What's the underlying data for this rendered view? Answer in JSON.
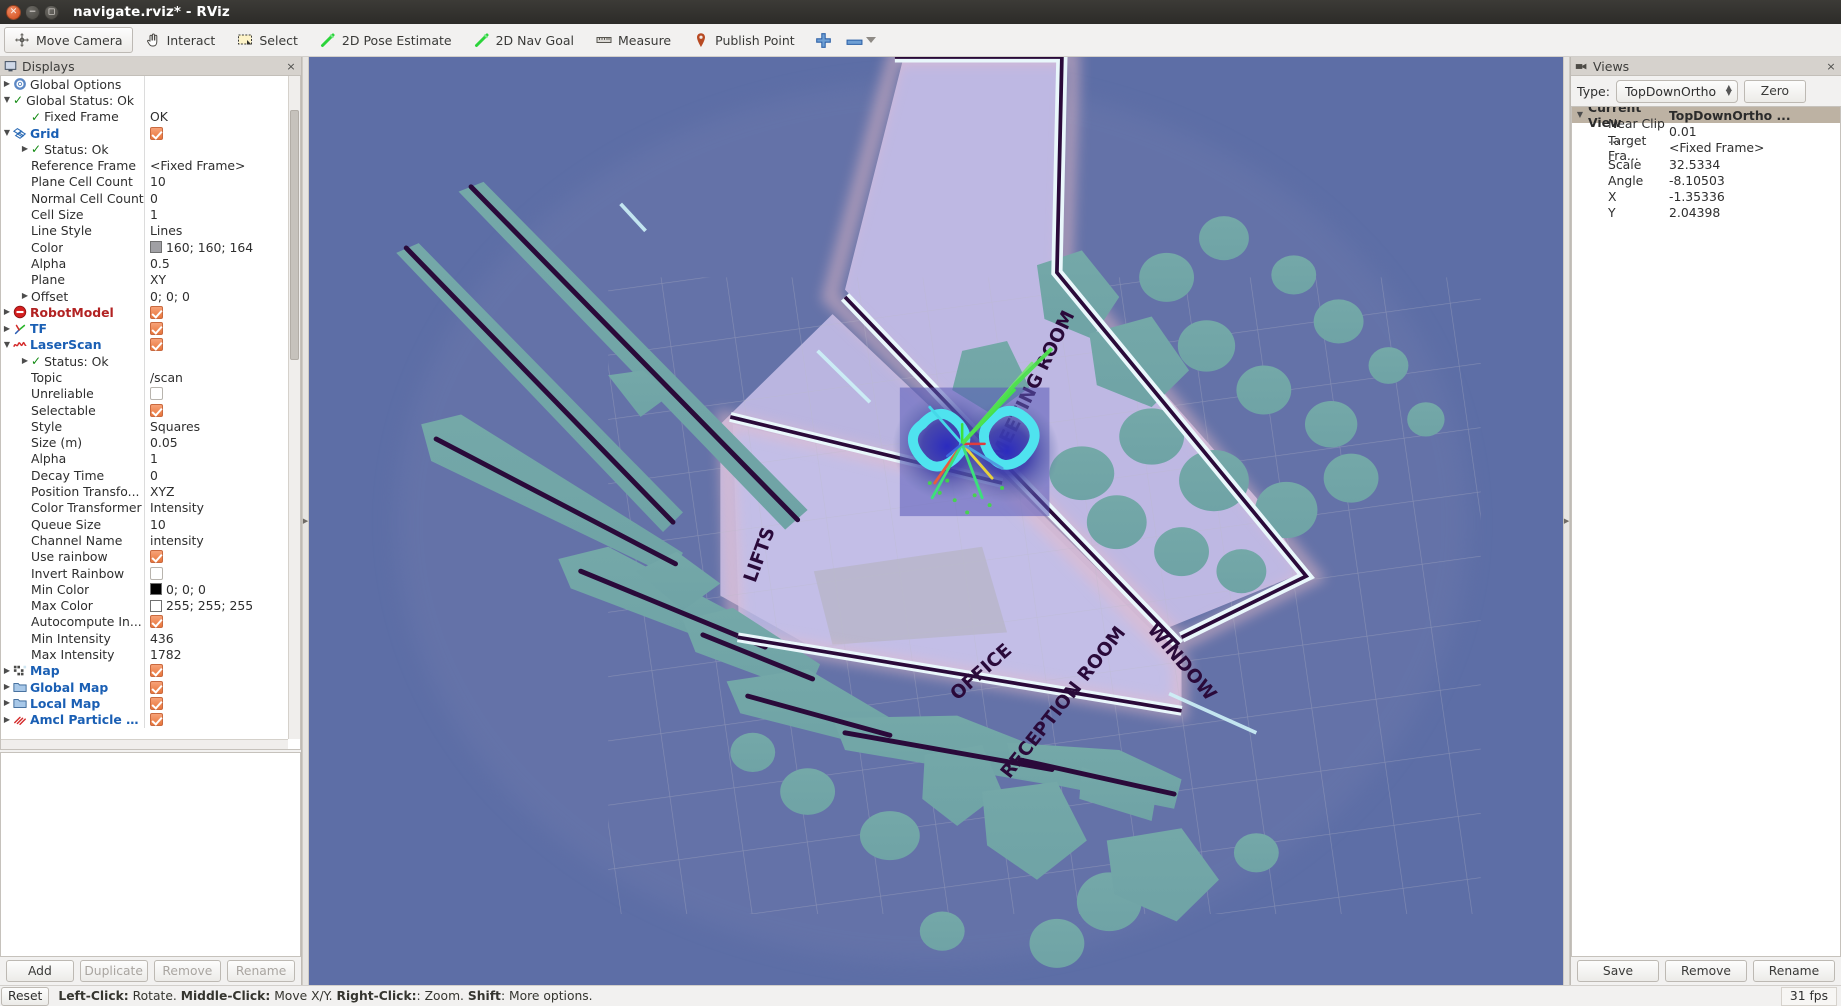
{
  "window": {
    "title": "navigate.rviz* - RViz",
    "controls": [
      "close",
      "minimize",
      "maximize"
    ]
  },
  "toolbar": {
    "items": [
      {
        "label": "Move Camera",
        "icon": "move-camera-icon",
        "active": true
      },
      {
        "label": "Interact",
        "icon": "hand-icon",
        "active": false
      },
      {
        "label": "Select",
        "icon": "select-rect-icon",
        "active": false
      },
      {
        "label": "2D Pose Estimate",
        "icon": "pose-arrow-icon",
        "active": false
      },
      {
        "label": "2D Nav Goal",
        "icon": "nav-goal-arrow-icon",
        "active": false
      },
      {
        "label": "Measure",
        "icon": "ruler-icon",
        "active": false
      },
      {
        "label": "Publish Point",
        "icon": "map-pin-icon",
        "active": false
      }
    ],
    "add_tool_icon": "plus-icon",
    "remove_tool_icon": "minus-icon",
    "remove_tool_caret": "chevron-down-icon"
  },
  "displays": {
    "title": "Displays",
    "icon": "displays-panel-icon",
    "close_label": "×",
    "tree": [
      {
        "indent": 0,
        "arrow": "right",
        "icon": "gear-icon",
        "name": "Global Options",
        "style": "plain",
        "value": "",
        "value_type": "none"
      },
      {
        "indent": 0,
        "arrow": "down",
        "icon": "check-icon",
        "name": "Global Status: Ok",
        "style": "plain",
        "value": "",
        "value_type": "none"
      },
      {
        "indent": 1,
        "arrow": "none",
        "icon": "check-icon",
        "name": "Fixed Frame",
        "style": "plain",
        "value": "OK",
        "value_type": "text"
      },
      {
        "indent": 0,
        "arrow": "down",
        "icon": "grid-icon",
        "name": "Grid",
        "style": "blue",
        "value": "",
        "value_type": "checked"
      },
      {
        "indent": 1,
        "arrow": "right",
        "icon": "check-icon",
        "name": "Status: Ok",
        "style": "plain",
        "value": "",
        "value_type": "none"
      },
      {
        "indent": 1,
        "arrow": "none",
        "icon": "none",
        "name": "Reference Frame",
        "style": "plain",
        "value": "<Fixed Frame>",
        "value_type": "text"
      },
      {
        "indent": 1,
        "arrow": "none",
        "icon": "none",
        "name": "Plane Cell Count",
        "style": "plain",
        "value": "10",
        "value_type": "text"
      },
      {
        "indent": 1,
        "arrow": "none",
        "icon": "none",
        "name": "Normal Cell Count",
        "style": "plain",
        "value": "0",
        "value_type": "text"
      },
      {
        "indent": 1,
        "arrow": "none",
        "icon": "none",
        "name": "Cell Size",
        "style": "plain",
        "value": "1",
        "value_type": "text"
      },
      {
        "indent": 1,
        "arrow": "none",
        "icon": "none",
        "name": "Line Style",
        "style": "plain",
        "value": "Lines",
        "value_type": "text"
      },
      {
        "indent": 1,
        "arrow": "none",
        "icon": "none",
        "name": "Color",
        "style": "plain",
        "value": "160; 160; 164",
        "value_type": "swatch",
        "swatch": "#a0a0a4"
      },
      {
        "indent": 1,
        "arrow": "none",
        "icon": "none",
        "name": "Alpha",
        "style": "plain",
        "value": "0.5",
        "value_type": "text"
      },
      {
        "indent": 1,
        "arrow": "none",
        "icon": "none",
        "name": "Plane",
        "style": "plain",
        "value": "XY",
        "value_type": "text"
      },
      {
        "indent": 1,
        "arrow": "right",
        "icon": "none",
        "name": "Offset",
        "style": "plain",
        "value": "0; 0; 0",
        "value_type": "text"
      },
      {
        "indent": 0,
        "arrow": "right",
        "icon": "robotmodel-error-icon",
        "name": "RobotModel",
        "style": "red",
        "value": "",
        "value_type": "checked"
      },
      {
        "indent": 0,
        "arrow": "right",
        "icon": "tf-axes-icon",
        "name": "TF",
        "style": "blue",
        "value": "",
        "value_type": "checked"
      },
      {
        "indent": 0,
        "arrow": "down",
        "icon": "laserscan-icon",
        "name": "LaserScan",
        "style": "blue",
        "value": "",
        "value_type": "checked"
      },
      {
        "indent": 1,
        "arrow": "right",
        "icon": "check-icon",
        "name": "Status: Ok",
        "style": "plain",
        "value": "",
        "value_type": "none"
      },
      {
        "indent": 1,
        "arrow": "none",
        "icon": "none",
        "name": "Topic",
        "style": "plain",
        "value": "/scan",
        "value_type": "text"
      },
      {
        "indent": 1,
        "arrow": "none",
        "icon": "none",
        "name": "Unreliable",
        "style": "plain",
        "value": "",
        "value_type": "unchecked"
      },
      {
        "indent": 1,
        "arrow": "none",
        "icon": "none",
        "name": "Selectable",
        "style": "plain",
        "value": "",
        "value_type": "checked"
      },
      {
        "indent": 1,
        "arrow": "none",
        "icon": "none",
        "name": "Style",
        "style": "plain",
        "value": "Squares",
        "value_type": "text"
      },
      {
        "indent": 1,
        "arrow": "none",
        "icon": "none",
        "name": "Size (m)",
        "style": "plain",
        "value": "0.05",
        "value_type": "text"
      },
      {
        "indent": 1,
        "arrow": "none",
        "icon": "none",
        "name": "Alpha",
        "style": "plain",
        "value": "1",
        "value_type": "text"
      },
      {
        "indent": 1,
        "arrow": "none",
        "icon": "none",
        "name": "Decay Time",
        "style": "plain",
        "value": "0",
        "value_type": "text"
      },
      {
        "indent": 1,
        "arrow": "none",
        "icon": "none",
        "name": "Position Transfo...",
        "style": "plain",
        "value": "XYZ",
        "value_type": "text"
      },
      {
        "indent": 1,
        "arrow": "none",
        "icon": "none",
        "name": "Color Transformer",
        "style": "plain",
        "value": "Intensity",
        "value_type": "text"
      },
      {
        "indent": 1,
        "arrow": "none",
        "icon": "none",
        "name": "Queue Size",
        "style": "plain",
        "value": "10",
        "value_type": "text"
      },
      {
        "indent": 1,
        "arrow": "none",
        "icon": "none",
        "name": "Channel Name",
        "style": "plain",
        "value": "intensity",
        "value_type": "text"
      },
      {
        "indent": 1,
        "arrow": "none",
        "icon": "none",
        "name": "Use rainbow",
        "style": "plain",
        "value": "",
        "value_type": "checked"
      },
      {
        "indent": 1,
        "arrow": "none",
        "icon": "none",
        "name": "Invert Rainbow",
        "style": "plain",
        "value": "",
        "value_type": "unchecked"
      },
      {
        "indent": 1,
        "arrow": "none",
        "icon": "none",
        "name": "Min Color",
        "style": "plain",
        "value": "0; 0; 0",
        "value_type": "swatch",
        "swatch": "#000000"
      },
      {
        "indent": 1,
        "arrow": "none",
        "icon": "none",
        "name": "Max Color",
        "style": "plain",
        "value": "255; 255; 255",
        "value_type": "swatch",
        "swatch": "#ffffff"
      },
      {
        "indent": 1,
        "arrow": "none",
        "icon": "none",
        "name": "Autocompute In...",
        "style": "plain",
        "value": "",
        "value_type": "checked"
      },
      {
        "indent": 1,
        "arrow": "none",
        "icon": "none",
        "name": "Min Intensity",
        "style": "plain",
        "value": "436",
        "value_type": "text"
      },
      {
        "indent": 1,
        "arrow": "none",
        "icon": "none",
        "name": "Max Intensity",
        "style": "plain",
        "value": "1782",
        "value_type": "text"
      },
      {
        "indent": 0,
        "arrow": "right",
        "icon": "map-grid-icon",
        "name": "Map",
        "style": "blue",
        "value": "",
        "value_type": "checked"
      },
      {
        "indent": 0,
        "arrow": "right",
        "icon": "group-folder-icon",
        "name": "Global Map",
        "style": "blue",
        "value": "",
        "value_type": "checked"
      },
      {
        "indent": 0,
        "arrow": "right",
        "icon": "group-folder-icon",
        "name": "Local Map",
        "style": "blue",
        "value": "",
        "value_type": "checked"
      },
      {
        "indent": 0,
        "arrow": "right",
        "icon": "particles-icon",
        "name": "Amcl Particle S...",
        "style": "blue",
        "value": "",
        "value_type": "checked"
      }
    ],
    "buttons": [
      {
        "label": "Add",
        "enabled": true
      },
      {
        "label": "Duplicate",
        "enabled": false
      },
      {
        "label": "Remove",
        "enabled": false
      },
      {
        "label": "Rename",
        "enabled": false
      }
    ]
  },
  "views": {
    "title": "Views",
    "icon": "views-panel-icon",
    "close_label": "×",
    "type_label": "Type:",
    "type_value": "TopDownOrtho",
    "zero_button": "Zero",
    "rows": [
      {
        "header": true,
        "arrow": "down",
        "name": "Current View",
        "value": "TopDownOrtho ..."
      },
      {
        "header": false,
        "arrow": "none",
        "name": "Near Clip ...",
        "value": "0.01"
      },
      {
        "header": false,
        "arrow": "none",
        "name": "Target Fra...",
        "value": "<Fixed Frame>"
      },
      {
        "header": false,
        "arrow": "none",
        "name": "Scale",
        "value": "32.5334"
      },
      {
        "header": false,
        "arrow": "none",
        "name": "Angle",
        "value": "-8.10503"
      },
      {
        "header": false,
        "arrow": "none",
        "name": "X",
        "value": "-1.35336"
      },
      {
        "header": false,
        "arrow": "none",
        "name": "Y",
        "value": "2.04398"
      }
    ],
    "buttons": [
      {
        "label": "Save",
        "enabled": true
      },
      {
        "label": "Remove",
        "enabled": true
      },
      {
        "label": "Rename",
        "enabled": true
      }
    ]
  },
  "statusbar": {
    "reset_label": "Reset",
    "hints": [
      {
        "bold": "Left-Click:",
        "text": " Rotate. "
      },
      {
        "bold": "Middle-Click:",
        "text": " Move X/Y. "
      },
      {
        "bold": "Right-Click:",
        "text": ": Zoom. "
      },
      {
        "bold": "Shift",
        "text": ": More options."
      }
    ],
    "fps": "31 fps"
  },
  "view3d": {
    "map_labels": [
      "MEETING ROOM",
      "LIFTS",
      "WINDOW",
      "OFFICE",
      "RECEPTION ROOM"
    ],
    "colors": {
      "free_space": "#5d6ea6",
      "unknown": "#b9b4e0",
      "obstacle_inflation": "#74a8a8",
      "wall": "#2a0a3a",
      "robot_footprint_cyan": "#4fe3ef",
      "costmap_core": "#2b2bbf",
      "grid_line": "#b9b9c6"
    }
  }
}
